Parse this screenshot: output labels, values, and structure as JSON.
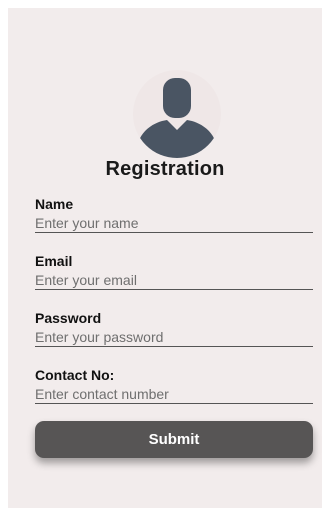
{
  "form": {
    "title": "Registration",
    "avatar_icon": "user-avatar-icon",
    "fields": [
      {
        "label": "Name",
        "placeholder": "Enter your name",
        "value": ""
      },
      {
        "label": "Email",
        "placeholder": "Enter your email",
        "value": ""
      },
      {
        "label": "Password",
        "placeholder": "Enter your password",
        "value": ""
      },
      {
        "label": "Contact No:",
        "placeholder": "Enter contact number",
        "value": ""
      }
    ],
    "submit_label": "Submit"
  },
  "colors": {
    "card_background": "#f2ecec",
    "avatar_icon": "#4a5563",
    "button_background": "#575555",
    "button_text": "#ffffff"
  }
}
